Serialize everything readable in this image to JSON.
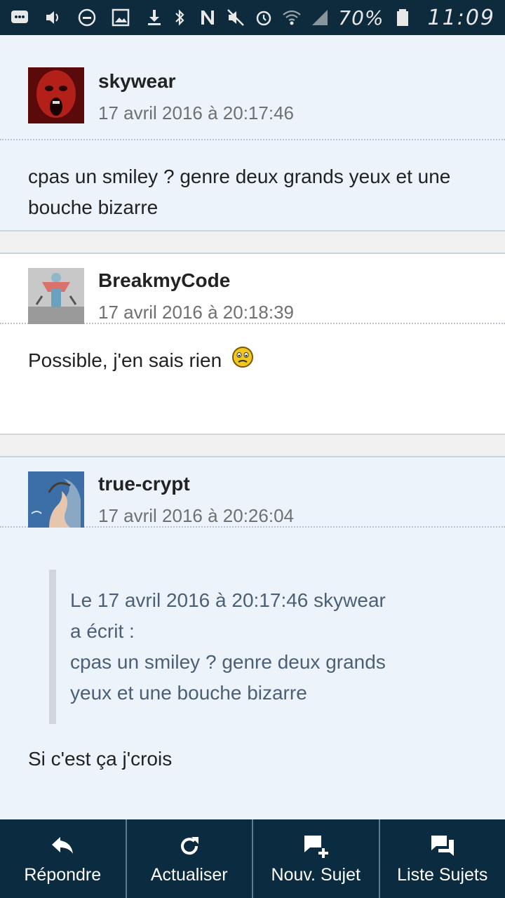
{
  "status_bar": {
    "battery": "70%",
    "time": "11:09",
    "icons": [
      "message-icon",
      "volume-icon",
      "do-not-disturb-icon",
      "image-icon",
      "download-icon",
      "bluetooth-icon",
      "nfc-icon",
      "mute-icon",
      "alarm-icon",
      "wifi-icon",
      "signal-icon",
      "battery-icon"
    ]
  },
  "posts": [
    {
      "username": "skywear",
      "timestamp": "17 avril 2016 à 20:17:46",
      "text_lines": [
        "cpas un smiley ? genre deux grands yeux et une",
        "bouche bizarre"
      ]
    },
    {
      "username": "BreakmyCode",
      "timestamp": "17 avril 2016 à 20:18:39",
      "text": "Possible, j'en sais rien"
    },
    {
      "username": "true-crypt",
      "timestamp": "17 avril 2016 à 20:26:04",
      "quote_lines": [
        "Le 17 avril 2016 à 20:17:46 skywear",
        "a écrit :",
        "cpas un smiley ? genre deux grands",
        "yeux et une bouche bizarre"
      ],
      "text": "Si c'est ça j'crois"
    }
  ],
  "toolbar": {
    "reply": "Répondre",
    "refresh": "Actualiser",
    "new_topic": "Nouv. Sujet",
    "topic_list": "Liste Sujets"
  },
  "colors": {
    "toolbar_bg": "#0b2b40",
    "post_blue_bg": "#edf3fb",
    "quote_text": "#4b6077"
  }
}
